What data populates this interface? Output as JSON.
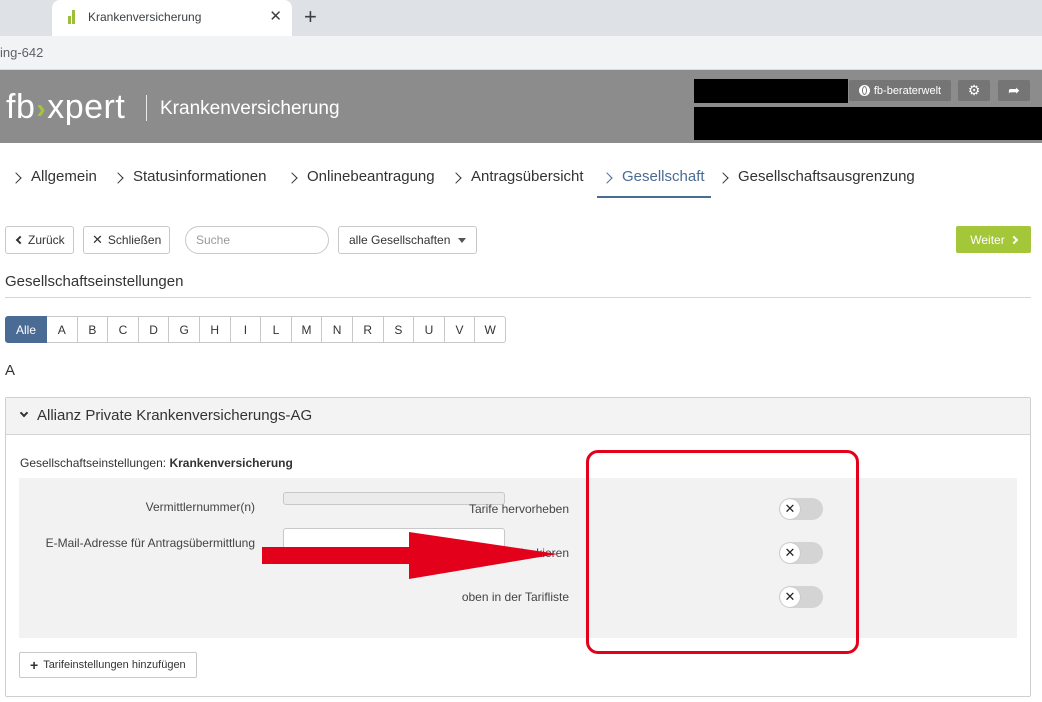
{
  "browser": {
    "tab_title": "Krankenversicherung",
    "tab_close": "✕",
    "new_tab": "+",
    "url_fragment": "ing-642"
  },
  "header": {
    "logo_left": "fb",
    "logo_chevron": "›",
    "logo_right": "xpert",
    "app_title": "Krankenversicherung",
    "berater_label": "fb-beraterwelt",
    "settings_icon": "⚙",
    "logout_icon": "➦"
  },
  "nav": {
    "items": [
      {
        "label": "Allgemein",
        "active": false
      },
      {
        "label": "Statusinformationen",
        "active": false
      },
      {
        "label": "Onlinebeantragung",
        "active": false
      },
      {
        "label": "Antragsübersicht",
        "active": false
      },
      {
        "label": "Gesellschaft",
        "active": true
      },
      {
        "label": "Gesellschaftsausgrenzung",
        "active": false
      }
    ]
  },
  "toolbar": {
    "back_label": "Zurück",
    "close_label": "Schließen",
    "search_placeholder": "Suche",
    "company_filter": "alle Gesellschaften",
    "next_label": "Weiter"
  },
  "section": {
    "title": "Gesellschaftseinstellungen"
  },
  "alphabet": {
    "letters": [
      "Alle",
      "A",
      "B",
      "C",
      "D",
      "G",
      "H",
      "I",
      "L",
      "M",
      "N",
      "R",
      "S",
      "U",
      "V",
      "W"
    ],
    "selected": "Alle"
  },
  "letter_heading": "A",
  "company": {
    "name": "Allianz Private Krankenversicherungs-AG",
    "settings_prefix": "Gesellschaftseinstellungen:",
    "settings_type": "Krankenversicherung",
    "fields": {
      "vermittler_label": "Vermittlernummer(n)",
      "vermittler_value": "",
      "email_label": "E-Mail-Adresse für Antragsübermittlung",
      "email_value": ""
    },
    "toggles": [
      {
        "label": "Tarife hervorheben",
        "state": "off"
      },
      {
        "label": "Beantragung blockieren",
        "state": "off"
      },
      {
        "label": "oben in der Tarifliste",
        "state": "off"
      }
    ],
    "toggle_off_glyph": "✕",
    "add_button_label": "Tarifeinstellungen hinzufügen"
  },
  "colors": {
    "brand_green": "#a4c639",
    "active_blue": "#4a6b94",
    "header_gray": "#8c8c8c",
    "annotation_red": "#e3001b"
  }
}
